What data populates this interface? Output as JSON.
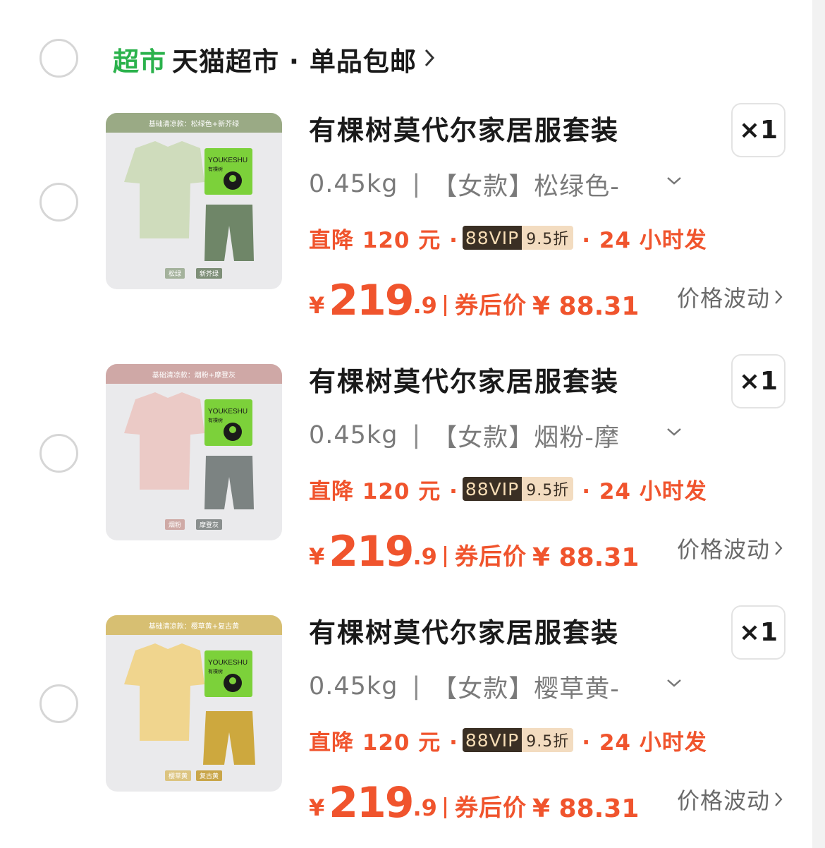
{
  "store": {
    "badge": "超市",
    "badge_color": "#2bb24c",
    "name": "天猫超市 · 单品包邮",
    "arrow_icon": "chevron-right-icon"
  },
  "items": [
    {
      "image": {
        "banner": "基础清凉款：松绿色+新芥绿",
        "banner_color": "#9aaa85",
        "shirt_color": "#cfdcbc",
        "shorts_color": "#6f8668",
        "box_color": "#7cd13a",
        "brand": "YOUKESHU",
        "brand_cn": "有棵树",
        "tags": [
          "松绿",
          "新芥绿"
        ],
        "tag_colors": [
          "#a4b29c",
          "#7e8f78"
        ]
      },
      "title": "有棵树莫代尔家居服套装",
      "quantity": "×1",
      "sku": {
        "weight": "0.45kg",
        "separator": "|",
        "variant": "【女款】松绿色-"
      },
      "promo": {
        "discount": "直降 120 元 ·",
        "vip_label": "88VIP",
        "vip_rate": "9.5折",
        "shipping": "· 24 小时发"
      },
      "price": {
        "currency": "¥",
        "integer": "219",
        "decimal": ".9",
        "after_label": "券后价",
        "after_value": "¥ 88.31"
      },
      "fluctuation": "价格波动"
    },
    {
      "image": {
        "banner": "基础清凉款：烟粉+摩登灰",
        "banner_color": "#cfa8a6",
        "shirt_color": "#ebcac6",
        "shorts_color": "#7c8382",
        "box_color": "#7cd13a",
        "brand": "YOUKESHU",
        "brand_cn": "有棵树",
        "tags": [
          "烟粉",
          "摩登灰"
        ],
        "tag_colors": [
          "#cfaaa6",
          "#8a8f8e"
        ]
      },
      "title": "有棵树莫代尔家居服套装",
      "quantity": "×1",
      "sku": {
        "weight": "0.45kg",
        "separator": "|",
        "variant": "【女款】烟粉-摩"
      },
      "promo": {
        "discount": "直降 120 元 ·",
        "vip_label": "88VIP",
        "vip_rate": "9.5折",
        "shipping": "· 24 小时发"
      },
      "price": {
        "currency": "¥",
        "integer": "219",
        "decimal": ".9",
        "after_label": "券后价",
        "after_value": "¥ 88.31"
      },
      "fluctuation": "价格波动"
    },
    {
      "image": {
        "banner": "基础清凉款：樱草黄+复古黄",
        "banner_color": "#d7bf72",
        "shirt_color": "#f0d58e",
        "shorts_color": "#cda83e",
        "box_color": "#7cd13a",
        "brand": "YOUKESHU",
        "brand_cn": "有棵树",
        "tags": [
          "樱草黄",
          "复古黄"
        ],
        "tag_colors": [
          "#dcc480",
          "#c9a64a"
        ]
      },
      "title": "有棵树莫代尔家居服套装",
      "quantity": "×1",
      "sku": {
        "weight": "0.45kg",
        "separator": "|",
        "variant": "【女款】樱草黄-"
      },
      "promo": {
        "discount": "直降 120 元 ·",
        "vip_label": "88VIP",
        "vip_rate": "9.5折",
        "shipping": "· 24 小时发"
      },
      "price": {
        "currency": "¥",
        "integer": "219",
        "decimal": ".9",
        "after_label": "券后价",
        "after_value": "¥ 88.31"
      },
      "fluctuation": "价格波动"
    }
  ]
}
